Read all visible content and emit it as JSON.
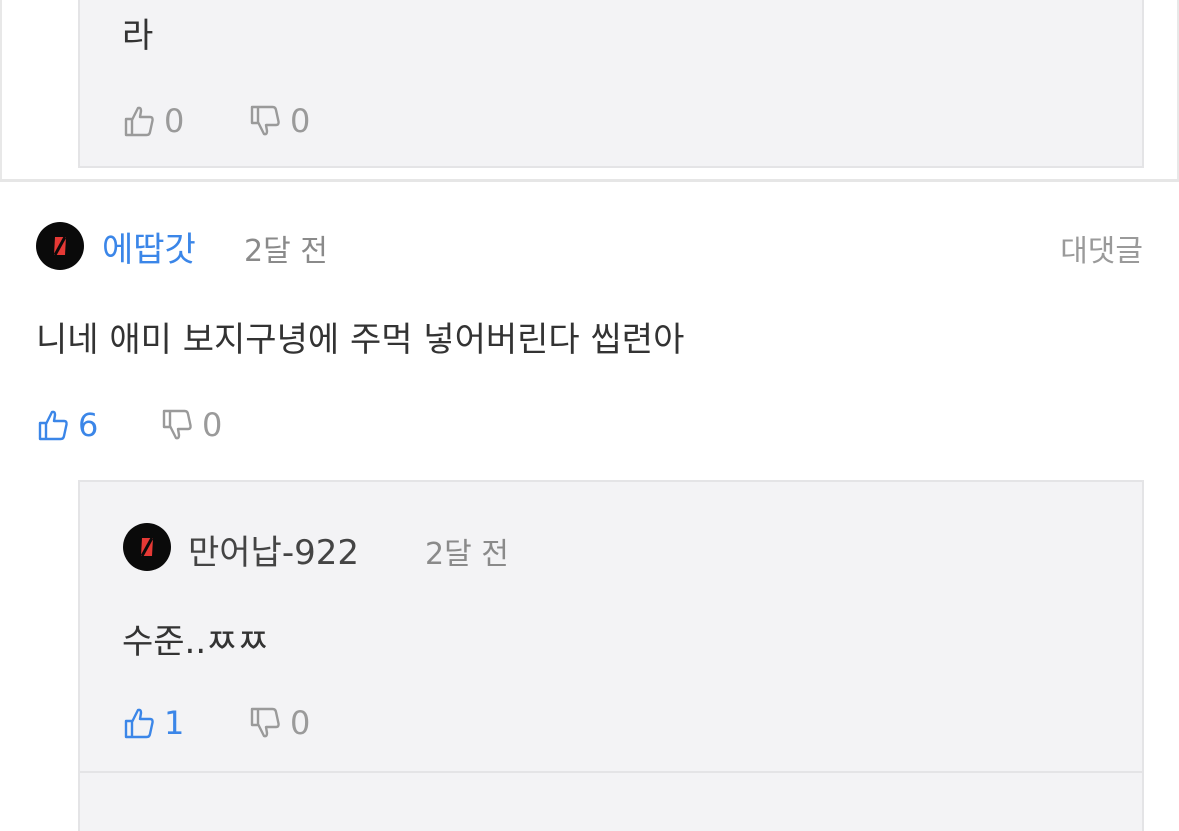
{
  "prev_reply": {
    "text": "라",
    "likes": "0",
    "dislikes": "0"
  },
  "comment": {
    "author": "에땁갓",
    "time": "2달 전",
    "reply_label": "대댓글",
    "text": "니네 애미 보지구녕에 주먹 넣어버린다 씹련아",
    "likes": "6",
    "dislikes": "0"
  },
  "reply": {
    "author": "만어납-922",
    "time": "2달 전",
    "text": "수준..ㅉㅉ",
    "likes": "1",
    "dislikes": "0"
  },
  "colors": {
    "accent": "#3b86e8",
    "muted": "#9a9a9a",
    "reply_bg": "#f3f3f5",
    "avatar_bg": "#0a0a0a",
    "avatar_mark": "#e53935"
  },
  "icons": [
    "thumbs-up-icon",
    "thumbs-down-icon",
    "avatar-logo-icon"
  ]
}
